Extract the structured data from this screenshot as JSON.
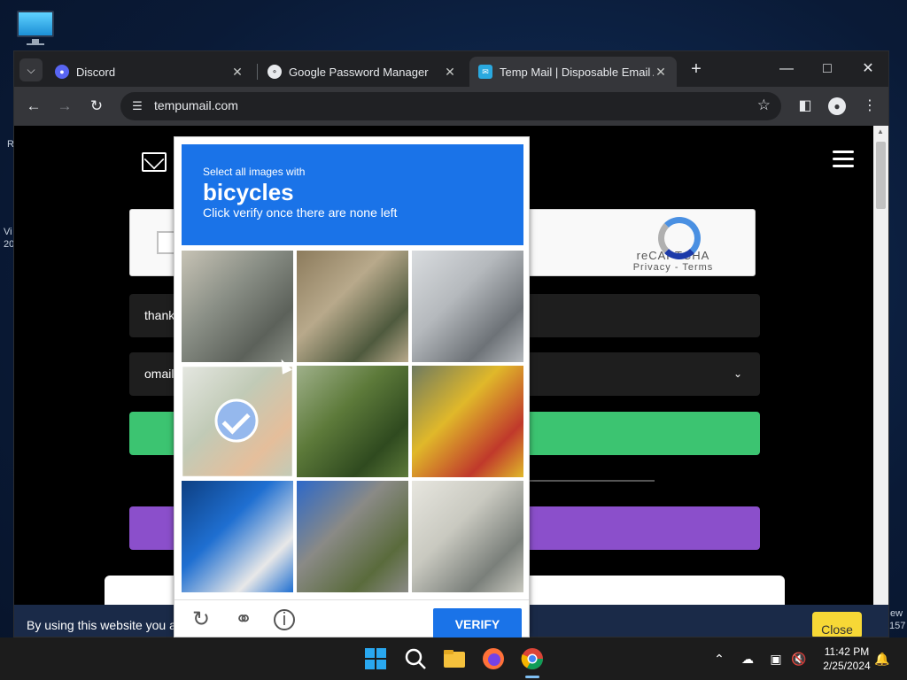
{
  "desktop": {
    "edge_text_left": [
      "R",
      "Vi",
      "20"
    ],
    "edge_text_right": [
      "ew",
      "157"
    ]
  },
  "browser": {
    "tabs": [
      {
        "title": "Discord",
        "favicon_color": "#5865f2",
        "active": false
      },
      {
        "title": "Google Password Manager",
        "favicon_color": "#e8eaed",
        "active": false
      },
      {
        "title": "Temp Mail | Disposable Email A",
        "favicon_color": "#2aa9e0",
        "active": true
      }
    ],
    "url": "tempumail.com"
  },
  "page": {
    "recaptcha_brand": "reCAPTCHA",
    "recaptcha_links": "Privacy - Terms",
    "field1_value": "thank",
    "field2_value": "omail",
    "cookie_text": "By using this website you a",
    "cookie_close": "Close"
  },
  "challenge": {
    "line1": "Select all images with",
    "keyword": "bicycles",
    "line3": "Click verify once there are none left",
    "verify_label": "VERIFY",
    "selected_tiles": [
      3
    ],
    "tiles": [
      {
        "desc": "bench-walkway",
        "colors": [
          "#8a8f86",
          "#5c615a",
          "#c7c3b5"
        ]
      },
      {
        "desc": "bicycle-alley",
        "colors": [
          "#b8a98b",
          "#4f5a3e",
          "#8c7b5c"
        ]
      },
      {
        "desc": "parked-bicycles",
        "colors": [
          "#b5b9bd",
          "#6d7277",
          "#d9dcdf"
        ]
      },
      {
        "desc": "person-on-bicycle",
        "colors": [
          "#8fa07c",
          "#d08a4a",
          "#cfd3c8"
        ]
      },
      {
        "desc": "palm-plants",
        "colors": [
          "#5d7a3a",
          "#2f4a1f",
          "#9fb08a"
        ]
      },
      {
        "desc": "yellow-bus",
        "colors": [
          "#e0b82a",
          "#c0392b",
          "#6e7a60"
        ]
      },
      {
        "desc": "blue-bike-frame",
        "colors": [
          "#1f6fd1",
          "#e8e8e8",
          "#0d3f82"
        ]
      },
      {
        "desc": "road-curve",
        "colors": [
          "#8a8a86",
          "#5a6b3c",
          "#2c68c9"
        ]
      },
      {
        "desc": "bicycle-shelter",
        "colors": [
          "#c9c9c0",
          "#7a7f7a",
          "#e7e6df"
        ]
      }
    ]
  },
  "taskbar": {
    "time": "11:42 PM",
    "date": "2/25/2024"
  }
}
